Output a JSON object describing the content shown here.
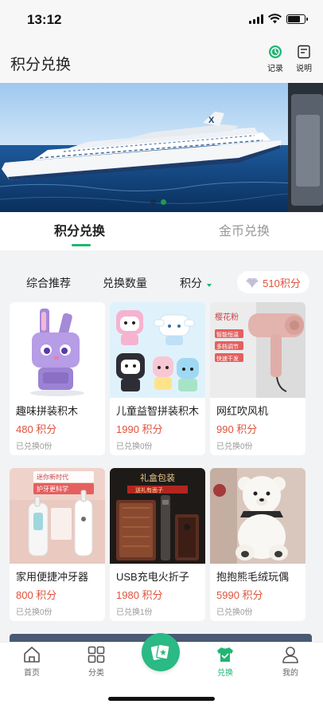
{
  "status_bar": {
    "time": "13:12",
    "battery_level": 0.75
  },
  "header": {
    "title": "积分兑换",
    "record_label": "记录",
    "explain_label": "说明",
    "record_icon": "clock-icon",
    "explain_icon": "document-icon"
  },
  "banner": {
    "slides": 2,
    "active_slide": 2,
    "image": "cruise-ship"
  },
  "tabs": {
    "points_exchange": "积分兑换",
    "coins_exchange": "金币兑换",
    "active": "points_exchange"
  },
  "filters": {
    "recommended": "综合推荐",
    "quantity": "兑换数量",
    "points": "积分",
    "balance": "510积分"
  },
  "products": [
    {
      "name": "趣味拼装积木",
      "price": "480 积分",
      "exchanged": "已兑换0份",
      "image": "purple-bunny-block-figure"
    },
    {
      "name": "儿童益智拼装积木",
      "price": "1990 积分",
      "exchanged": "已兑换0份",
      "image": "sanrio-block-figures"
    },
    {
      "name": "网红吹风机",
      "price": "990 积分",
      "exchanged": "已兑换0份",
      "image": "pink-hair-dryer",
      "badge": [
        "樱花粉",
        "智能恒温",
        "多档调节",
        "快速干发"
      ]
    },
    {
      "name": "家用便捷冲牙器",
      "price": "800 积分",
      "exchanged": "已兑换0份",
      "image": "water-flosser",
      "badge": [
        "迷你新时代",
        "护牙更科学"
      ]
    },
    {
      "name": "USB充电火折子",
      "price": "1980 积分",
      "exchanged": "已兑换1份",
      "image": "gift-box-fire-starter",
      "badge": [
        "礼盒包装",
        "送礼有面子"
      ]
    },
    {
      "name": "抱抱熊毛绒玩偶",
      "price": "5990 积分",
      "exchanged": "已兑换0份",
      "image": "white-teddy-bear"
    }
  ],
  "tabbar": {
    "home": "首页",
    "category": "分类",
    "exchange": "兑换",
    "mine": "我的",
    "active": "exchange"
  },
  "colors": {
    "accent": "#21b573",
    "price": "#e0533c",
    "muted": "#999999"
  }
}
